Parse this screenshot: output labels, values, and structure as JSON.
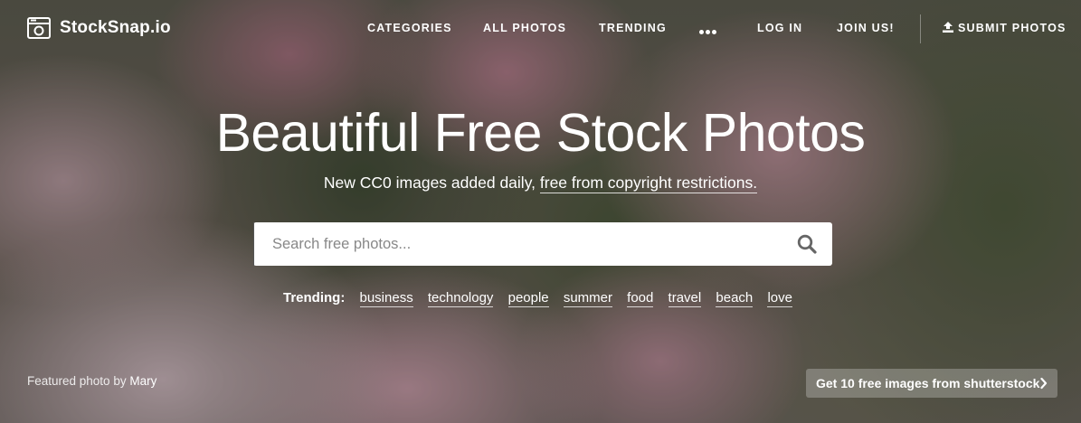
{
  "header": {
    "brand": "StockSnap.io",
    "nav": {
      "categories": "CATEGORIES",
      "all_photos": "ALL PHOTOS",
      "trending": "TRENDING",
      "login": "LOG IN",
      "join": "JOIN US!",
      "submit": "SUBMIT PHOTOS"
    }
  },
  "hero": {
    "title": "Beautiful Free Stock Photos",
    "subtitle_prefix": "New CC0 images added daily, ",
    "subtitle_link": "free from copyright restrictions.",
    "search": {
      "placeholder": "Search free photos..."
    },
    "trending_label": "Trending:",
    "trending_terms": [
      "business",
      "technology",
      "people",
      "summer",
      "food",
      "travel",
      "beach",
      "love"
    ]
  },
  "footer": {
    "featured_prefix": "Featured photo by ",
    "featured_author": "Mary",
    "promo": "Get 10 free images from shutterstock"
  },
  "colors": {
    "text": "#ffffff",
    "search_bg": "#ffffff",
    "search_icon": "#666666"
  },
  "icons": [
    "camera-logo-icon",
    "more-dots-icon",
    "upload-icon",
    "search-icon",
    "chevron-right-icon"
  ]
}
